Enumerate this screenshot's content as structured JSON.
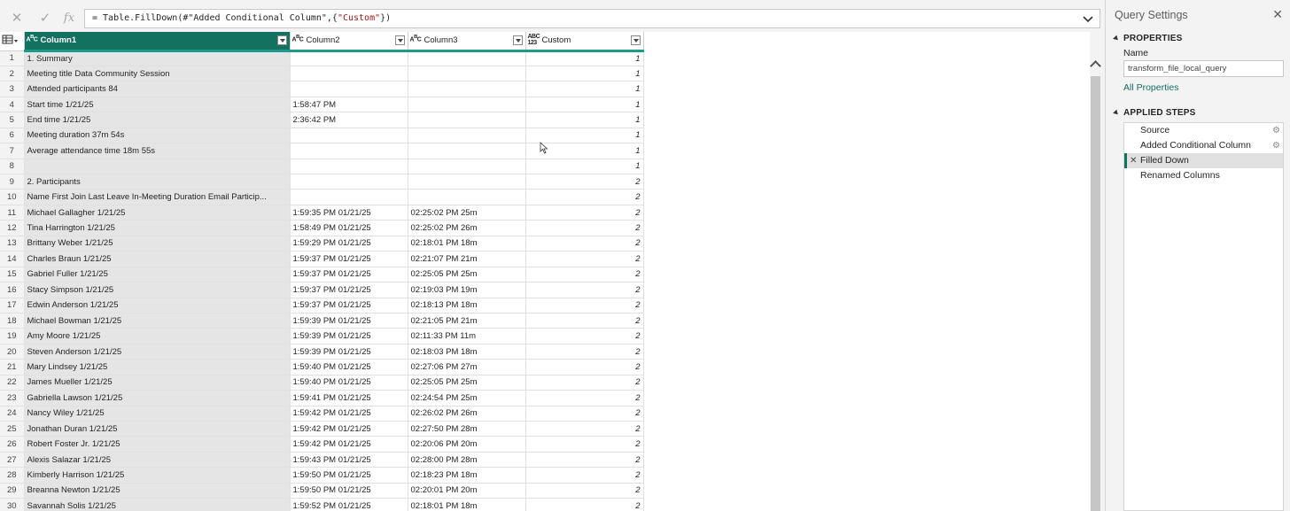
{
  "formula_bar": {
    "prefix": "= Table.FillDown(#\"Added Conditional Column\",{",
    "string_arg": "\"Custom\"",
    "suffix": "})",
    "cancel_icon": "x-icon",
    "commit_icon": "check-icon",
    "fx_label": "fx"
  },
  "grid": {
    "columns": [
      {
        "name": "Column1",
        "type_icon": "ABC"
      },
      {
        "name": "Column2",
        "type_icon": "ABC"
      },
      {
        "name": "Column3",
        "type_icon": "ABC"
      },
      {
        "name": "Custom",
        "type_icon": "ABC/123"
      }
    ],
    "rows": [
      {
        "n": "1",
        "c1": "1. Summary",
        "c2": "",
        "c3": "",
        "c4": "1"
      },
      {
        "n": "2",
        "c1": "Meeting title Data Community Session",
        "c2": "",
        "c3": "",
        "c4": "1"
      },
      {
        "n": "3",
        "c1": "Attended participants 84",
        "c2": "",
        "c3": "",
        "c4": "1"
      },
      {
        "n": "4",
        "c1": "Start time      1/21/25",
        "c2": "1:58:47 PM",
        "c3": "",
        "c4": "1"
      },
      {
        "n": "5",
        "c1": "End time        1/21/25",
        "c2": "2:36:42 PM",
        "c3": "",
        "c4": "1"
      },
      {
        "n": "6",
        "c1": "Meeting duration 37m 54s",
        "c2": "",
        "c3": "",
        "c4": "1"
      },
      {
        "n": "7",
        "c1": "Average attendance time   18m 55s",
        "c2": "",
        "c3": "",
        "c4": "1"
      },
      {
        "n": "8",
        "c1": "",
        "c2": "",
        "c3": "",
        "c4": "1"
      },
      {
        "n": "9",
        "c1": "2. Participants",
        "c2": "",
        "c3": "",
        "c4": "2"
      },
      {
        "n": "10",
        "c1": "Name     First Join Last Leave     In-Meeting Duration    Email      Particip...",
        "c2": "",
        "c3": "",
        "c4": "2"
      },
      {
        "n": "11",
        "c1": "Michael Gallagher        1/21/25",
        "c2": "1:59:35 PM  01/21/25",
        "c3": "02:25:02 PM 25m",
        "c4": "2"
      },
      {
        "n": "12",
        "c1": "Tina Harrington    1/21/25",
        "c2": "1:58:49 PM  01/21/25",
        "c3": "02:25:02 PM 26m",
        "c4": "2"
      },
      {
        "n": "13",
        "c1": "Brittany Weber     1/21/25",
        "c2": "1:59:29 PM  01/21/25",
        "c3": "02:18:01 PM 18m",
        "c4": "2"
      },
      {
        "n": "14",
        "c1": "Charles Braun       1/21/25",
        "c2": "1:59:37 PM  01/21/25",
        "c3": "02:21:07 PM 21m",
        "c4": "2"
      },
      {
        "n": "15",
        "c1": "Gabriel Fuller       1/21/25",
        "c2": "1:59:37 PM  01/21/25",
        "c3": "02:25:05 PM 25m",
        "c4": "2"
      },
      {
        "n": "16",
        "c1": "Stacy Simpson      1/21/25",
        "c2": "1:59:37 PM  01/21/25",
        "c3": "02:19:03 PM 19m",
        "c4": "2"
      },
      {
        "n": "17",
        "c1": "Edwin Anderson    1/21/25",
        "c2": "1:59:37 PM  01/21/25",
        "c3": "02:18:13 PM 18m",
        "c4": "2"
      },
      {
        "n": "18",
        "c1": "Michael Bowman  1/21/25",
        "c2": "1:59:39 PM  01/21/25",
        "c3": "02:21:05 PM 21m",
        "c4": "2"
      },
      {
        "n": "19",
        "c1": "Amy Moore   1/21/25",
        "c2": "1:59:39 PM  01/21/25",
        "c3": "02:11:33 PM 11m",
        "c4": "2"
      },
      {
        "n": "20",
        "c1": "Steven Anderson  1/21/25",
        "c2": "1:59:39 PM  01/21/25",
        "c3": "02:18:03 PM 18m",
        "c4": "2"
      },
      {
        "n": "21",
        "c1": "Mary Lindsey 1/21/25",
        "c2": "1:59:40 PM  01/21/25",
        "c3": "02:27:06 PM 27m",
        "c4": "2"
      },
      {
        "n": "22",
        "c1": "James Mueller      1/21/25",
        "c2": "1:59:40 PM  01/21/25",
        "c3": "02:25:05 PM 25m",
        "c4": "2"
      },
      {
        "n": "23",
        "c1": "Gabriella Lawson  1/21/25",
        "c2": "1:59:41 PM  01/21/25",
        "c3": "02:24:54 PM 25m",
        "c4": "2"
      },
      {
        "n": "24",
        "c1": "Nancy Wiley  1/21/25",
        "c2": "1:59:42 PM  01/21/25",
        "c3": "02:26:02 PM 26m",
        "c4": "2"
      },
      {
        "n": "25",
        "c1": "Jonathan Duran     1/21/25",
        "c2": "1:59:42 PM  01/21/25",
        "c3": "02:27:50 PM 28m",
        "c4": "2"
      },
      {
        "n": "26",
        "c1": "Robert Foster Jr.   1/21/25",
        "c2": "1:59:42 PM  01/21/25",
        "c3": "02:20:06 PM 20m",
        "c4": "2"
      },
      {
        "n": "27",
        "c1": "Alexis Salazar      1/21/25",
        "c2": "1:59:43 PM  01/21/25",
        "c3": "02:28:00 PM 28m",
        "c4": "2"
      },
      {
        "n": "28",
        "c1": "Kimberly Harrison        1/21/25",
        "c2": "1:59:50 PM  01/21/25",
        "c3": "02:18:23 PM 18m",
        "c4": "2"
      },
      {
        "n": "29",
        "c1": "Breanna Newton  1/21/25",
        "c2": "1:59:50 PM  01/21/25",
        "c3": "02:20:01 PM 20m",
        "c4": "2"
      },
      {
        "n": "30",
        "c1": "Savannah Solis     1/21/25",
        "c2": "1:59:52 PM  01/21/25",
        "c3": "02:18:01 PM 18m",
        "c4": "2"
      }
    ]
  },
  "query_settings": {
    "title": "Query Settings",
    "properties_header": "PROPERTIES",
    "name_label": "Name",
    "name_value": "transform_file_local_query",
    "all_properties_link": "All Properties",
    "applied_steps_header": "APPLIED STEPS",
    "steps": [
      {
        "label": "Source",
        "has_gear": true,
        "active": false
      },
      {
        "label": "Added Conditional Column",
        "has_gear": true,
        "active": false
      },
      {
        "label": "Filled Down",
        "has_gear": false,
        "active": true
      },
      {
        "label": "Renamed Columns",
        "has_gear": false,
        "active": false
      }
    ]
  },
  "colors": {
    "accent": "#12715f",
    "header_underline": "#1e9a88",
    "string_literal": "#a31515"
  }
}
